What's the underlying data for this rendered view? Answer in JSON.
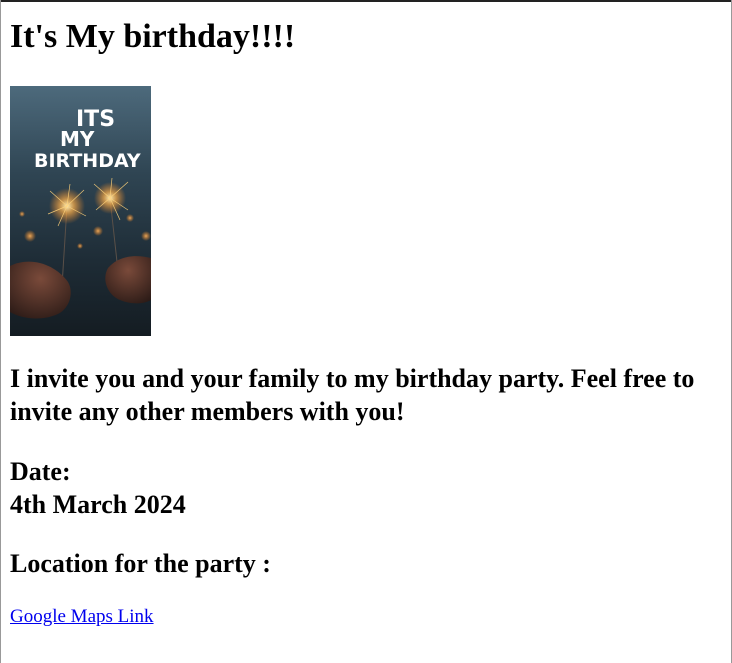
{
  "page": {
    "title": "It's My birthday!!!!"
  },
  "poster": {
    "line1": "ITS",
    "line2": "MY",
    "line3": "BIRTHDAY"
  },
  "invitation": {
    "text": "I invite you and your family to my birthday party. Feel free to invite any other members with you!"
  },
  "date": {
    "label": "Date:",
    "value": "4th March 2024"
  },
  "location": {
    "heading": "Location for the party :",
    "link_text": "Google Maps Link"
  },
  "colors": {
    "link": "#0000ee",
    "text": "#000000",
    "background": "#ffffff"
  }
}
